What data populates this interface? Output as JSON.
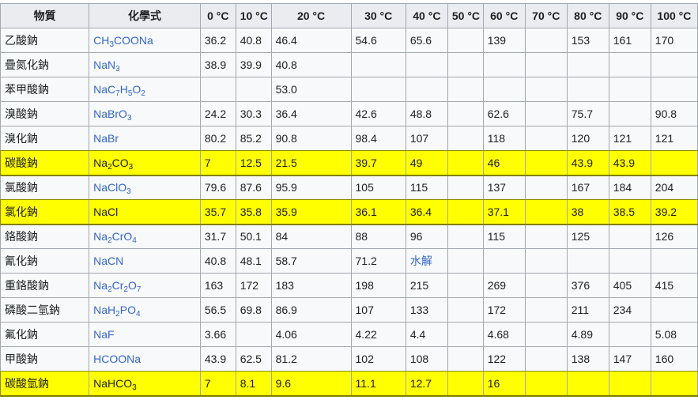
{
  "table": {
    "headers": [
      "物質",
      "化學式",
      "0 °C",
      "10 °C",
      "20 °C",
      "30 °C",
      "40 °C",
      "50 °C",
      "60 °C",
      "70 °C",
      "80 °C",
      "90 °C",
      "100 °C"
    ],
    "rows": [
      {
        "name": "乙酸鈉",
        "formula": [
          [
            "CH",
            ""
          ],
          [
            "3",
            "sub"
          ],
          [
            "COONa",
            ""
          ]
        ],
        "values": [
          "36.2",
          "40.8",
          "46.4",
          "54.6",
          "65.6",
          "",
          "139",
          "",
          "153",
          "161",
          "170"
        ],
        "highlight": false
      },
      {
        "name": "疊氮化鈉",
        "formula": [
          [
            "NaN",
            ""
          ],
          [
            "3",
            "sub"
          ]
        ],
        "values": [
          "38.9",
          "39.9",
          "40.8",
          "",
          "",
          "",
          "",
          "",
          "",
          "",
          ""
        ],
        "highlight": false,
        "name_link": true
      },
      {
        "name": "苯甲酸鈉",
        "formula": [
          [
            "NaC",
            ""
          ],
          [
            "7",
            "sub"
          ],
          [
            "H",
            ""
          ],
          [
            "5",
            "sub"
          ],
          [
            "O",
            ""
          ],
          [
            "2",
            "sub"
          ]
        ],
        "values": [
          "",
          "",
          "53.0",
          "",
          "",
          "",
          "",
          "",
          "",
          "",
          ""
        ],
        "highlight": false,
        "name_link": true
      },
      {
        "name": "溴酸鈉",
        "formula": [
          [
            "NaBrO",
            ""
          ],
          [
            "3",
            "sub"
          ]
        ],
        "values": [
          "24.2",
          "30.3",
          "36.4",
          "42.6",
          "48.8",
          "",
          "62.6",
          "",
          "75.7",
          "",
          "90.8"
        ],
        "highlight": false
      },
      {
        "name": "溴化鈉",
        "formula": [
          [
            "NaBr",
            ""
          ]
        ],
        "values": [
          "80.2",
          "85.2",
          "90.8",
          "98.4",
          "107",
          "",
          "118",
          "",
          "120",
          "121",
          "121"
        ],
        "highlight": false
      },
      {
        "name": "碳酸鈉",
        "formula": [
          [
            "Na",
            ""
          ],
          [
            "2",
            "sub"
          ],
          [
            "CO",
            ""
          ],
          [
            "3",
            "sub"
          ]
        ],
        "values": [
          "7",
          "12.5",
          "21.5",
          "39.7",
          "49",
          "",
          "46",
          "",
          "43.9",
          "43.9",
          ""
        ],
        "highlight": true
      },
      {
        "name": "氯酸鈉",
        "formula": [
          [
            "NaClO",
            ""
          ],
          [
            "3",
            "sub"
          ]
        ],
        "values": [
          "79.6",
          "87.6",
          "95.9",
          "105",
          "115",
          "",
          "137",
          "",
          "167",
          "184",
          "204"
        ],
        "highlight": false
      },
      {
        "name": "氯化鈉",
        "formula": [
          [
            "NaCl",
            ""
          ]
        ],
        "values": [
          "35.7",
          "35.8",
          "35.9",
          "36.1",
          "36.4",
          "",
          "37.1",
          "",
          "38",
          "38.5",
          "39.2"
        ],
        "highlight": true
      },
      {
        "name": "鉻酸鈉",
        "formula": [
          [
            "Na",
            ""
          ],
          [
            "2",
            "sub"
          ],
          [
            "CrO",
            ""
          ],
          [
            "4",
            "sub"
          ]
        ],
        "values": [
          "31.7",
          "50.1",
          "84",
          "88",
          "96",
          "",
          "115",
          "",
          "125",
          "",
          "126"
        ],
        "highlight": false
      },
      {
        "name": "氰化鈉",
        "formula": [
          [
            "NaCN",
            ""
          ]
        ],
        "values": [
          "40.8",
          "48.1",
          "58.7",
          "71.2",
          "水解",
          "",
          "",
          "",
          "",
          "",
          ""
        ],
        "highlight": false,
        "link_cols": [
          4
        ]
      },
      {
        "name": "重鉻酸鈉",
        "formula": [
          [
            "Na",
            ""
          ],
          [
            "2",
            "sub"
          ],
          [
            "Cr",
            ""
          ],
          [
            "2",
            "sub"
          ],
          [
            "O",
            ""
          ],
          [
            "7",
            "sub"
          ]
        ],
        "values": [
          "163",
          "172",
          "183",
          "198",
          "215",
          "",
          "269",
          "",
          "376",
          "405",
          "415"
        ],
        "highlight": false
      },
      {
        "name": "磷酸二氫鈉",
        "formula": [
          [
            "NaH",
            ""
          ],
          [
            "2",
            "sub"
          ],
          [
            "PO",
            ""
          ],
          [
            "4",
            "sub"
          ]
        ],
        "values": [
          "56.5",
          "69.8",
          "86.9",
          "107",
          "133",
          "",
          "172",
          "",
          "211",
          "234",
          ""
        ],
        "highlight": false
      },
      {
        "name": "氟化鈉",
        "formula": [
          [
            "NaF",
            ""
          ]
        ],
        "values": [
          "3.66",
          "",
          "4.06",
          "4.22",
          "4.4",
          "",
          "4.68",
          "",
          "4.89",
          "",
          "5.08"
        ],
        "highlight": false
      },
      {
        "name": "甲酸鈉",
        "formula": [
          [
            "HCOONa",
            ""
          ]
        ],
        "values": [
          "43.9",
          "62.5",
          "81.2",
          "102",
          "108",
          "",
          "122",
          "",
          "138",
          "147",
          "160"
        ],
        "highlight": false
      },
      {
        "name": "碳酸氫鈉",
        "formula": [
          [
            "NaHCO",
            ""
          ],
          [
            "3",
            "sub"
          ]
        ],
        "values": [
          "7",
          "8.1",
          "9.6",
          "11.1",
          "12.7",
          "",
          "16",
          "",
          "",
          "",
          ""
        ],
        "highlight": true
      }
    ]
  }
}
